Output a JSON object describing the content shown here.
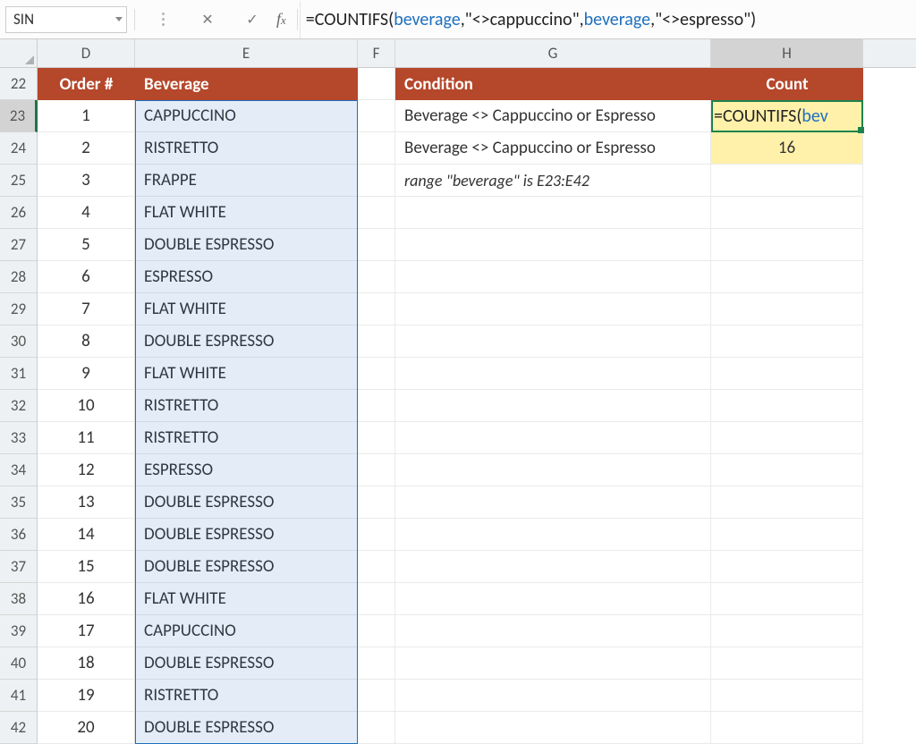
{
  "nameBox": "SIN",
  "formulaBar": {
    "prefix": "=COUNTIFS(",
    "arg1": "beverage",
    "sep1": ",\"<>cappuccino\",",
    "arg2": "beverage",
    "suffix": ",\"<>espresso\")"
  },
  "columns": [
    "D",
    "E",
    "F",
    "G",
    "H"
  ],
  "rowStart": 22,
  "rowEnd": 42,
  "headers": {
    "D": "Order #",
    "E": "Beverage",
    "G": "Condition",
    "H": "Count"
  },
  "beverageData": [
    {
      "order": "1",
      "bev": "CAPPUCCINO"
    },
    {
      "order": "2",
      "bev": "RISTRETTO"
    },
    {
      "order": "3",
      "bev": "FRAPPE"
    },
    {
      "order": "4",
      "bev": "FLAT WHITE"
    },
    {
      "order": "5",
      "bev": "DOUBLE ESPRESSO"
    },
    {
      "order": "6",
      "bev": "ESPRESSO"
    },
    {
      "order": "7",
      "bev": "FLAT WHITE"
    },
    {
      "order": "8",
      "bev": "DOUBLE ESPRESSO"
    },
    {
      "order": "9",
      "bev": "FLAT WHITE"
    },
    {
      "order": "10",
      "bev": "RISTRETTO"
    },
    {
      "order": "11",
      "bev": "RISTRETTO"
    },
    {
      "order": "12",
      "bev": "ESPRESSO"
    },
    {
      "order": "13",
      "bev": "DOUBLE ESPRESSO"
    },
    {
      "order": "14",
      "bev": "DOUBLE ESPRESSO"
    },
    {
      "order": "15",
      "bev": "DOUBLE ESPRESSO"
    },
    {
      "order": "16",
      "bev": "FLAT WHITE"
    },
    {
      "order": "17",
      "bev": "CAPPUCCINO"
    },
    {
      "order": "18",
      "bev": "DOUBLE ESPRESSO"
    },
    {
      "order": "19",
      "bev": "RISTRETTO"
    },
    {
      "order": "20",
      "bev": "DOUBLE ESPRESSO"
    }
  ],
  "condition": {
    "row23": "Beverage <> Cappuccino or Espresso",
    "row24": "Beverage <> Cappuccino or Espresso"
  },
  "count": {
    "row23_display_prefix": "=COUNTIFS(",
    "row23_display_arg": "bev",
    "row24": "16"
  },
  "note": "range \"beverage\" is E23:E42"
}
